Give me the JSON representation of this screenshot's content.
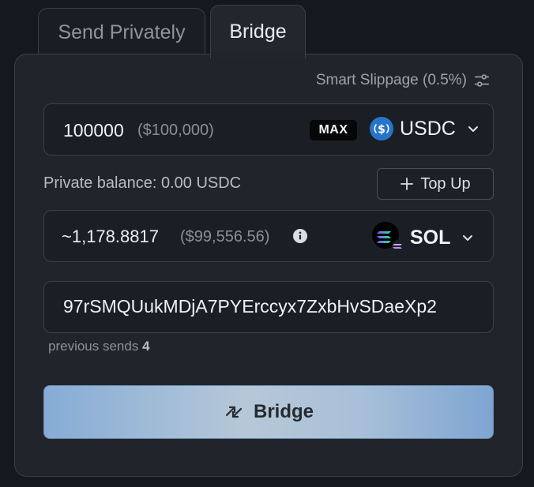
{
  "tabs": [
    {
      "label": "Send Privately",
      "active": false
    },
    {
      "label": "Bridge",
      "active": true
    }
  ],
  "slippage": {
    "label": "Smart Slippage (0.5%)",
    "icon": "sliders-icon"
  },
  "send": {
    "amount": "100000",
    "amount_usd": "($100,000)",
    "max_label": "MAX",
    "token": {
      "symbol": "USDC",
      "icon": "usdc-icon",
      "color": "#2775ca"
    }
  },
  "balance": {
    "label": "Private balance: 0.00 USDC"
  },
  "topup": {
    "label": "Top Up",
    "icon": "plus-icon"
  },
  "receive": {
    "amount": "~1,178.8817",
    "amount_usd": "($99,556.56)",
    "info_icon": "info-icon",
    "token": {
      "symbol": "SOL",
      "icon": "solana-icon"
    }
  },
  "address": {
    "value": "97rSMQUukMDjA7PYErccyx7ZxbHvSDaeXp2"
  },
  "previous_sends": {
    "label": "previous sends",
    "count": "4"
  },
  "bridge_button": {
    "label": "Bridge",
    "icon": "swap-arrows-icon"
  }
}
